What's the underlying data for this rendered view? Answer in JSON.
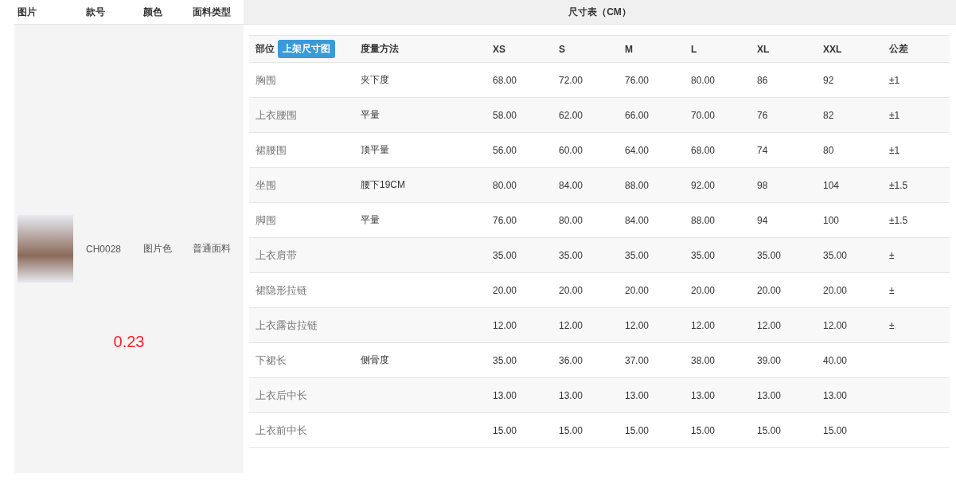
{
  "product_table": {
    "columns": [
      "图片",
      "款号",
      "颜色",
      "面料类型"
    ],
    "style_no": "CH0028",
    "colorway": "图片色",
    "fabric": "普通面料",
    "price": "0.23"
  },
  "size_chart": {
    "title": "尺寸表（CM）",
    "part_header": "部位",
    "chart_button": "上架尺寸图",
    "method_header": "度量方法",
    "sizes": [
      "XS",
      "S",
      "M",
      "L",
      "XL",
      "XXL"
    ],
    "tolerance_header": "公差",
    "rows": [
      {
        "part": "胸围",
        "method": "夹下度",
        "values": [
          "68.00",
          "72.00",
          "76.00",
          "80.00",
          "86",
          "92"
        ],
        "tolerance": "±1"
      },
      {
        "part": "上衣腰围",
        "method": "平量",
        "values": [
          "58.00",
          "62.00",
          "66.00",
          "70.00",
          "76",
          "82"
        ],
        "tolerance": "±1"
      },
      {
        "part": "裙腰围",
        "method": "顶平量",
        "values": [
          "56.00",
          "60.00",
          "64.00",
          "68.00",
          "74",
          "80"
        ],
        "tolerance": "±1"
      },
      {
        "part": "坐围",
        "method": "腰下19CM",
        "values": [
          "80.00",
          "84.00",
          "88.00",
          "92.00",
          "98",
          "104"
        ],
        "tolerance": "±1.5"
      },
      {
        "part": "脚围",
        "method": "平量",
        "values": [
          "76.00",
          "80.00",
          "84.00",
          "88.00",
          "94",
          "100"
        ],
        "tolerance": "±1.5"
      },
      {
        "part": "上衣肩带",
        "values": [
          "35.00",
          "35.00",
          "35.00",
          "35.00",
          "35.00",
          "35.00"
        ],
        "tolerance": "±"
      },
      {
        "part": "裙隐形拉链",
        "values": [
          "20.00",
          "20.00",
          "20.00",
          "20.00",
          "20.00",
          "20.00"
        ],
        "tolerance": "±"
      },
      {
        "part": "上衣露齿拉链",
        "values": [
          "12.00",
          "12.00",
          "12.00",
          "12.00",
          "12.00",
          "12.00"
        ],
        "tolerance": "±"
      },
      {
        "part": "下裙长",
        "method": "侧骨度",
        "values": [
          "35.00",
          "36.00",
          "37.00",
          "38.00",
          "39.00",
          "40.00"
        ]
      },
      {
        "part": "上衣后中长",
        "values": [
          "13.00",
          "13.00",
          "13.00",
          "13.00",
          "13.00",
          "13.00"
        ]
      },
      {
        "part": "上衣前中长",
        "values": [
          "15.00",
          "15.00",
          "15.00",
          "15.00",
          "15.00",
          "15.00"
        ]
      }
    ]
  }
}
